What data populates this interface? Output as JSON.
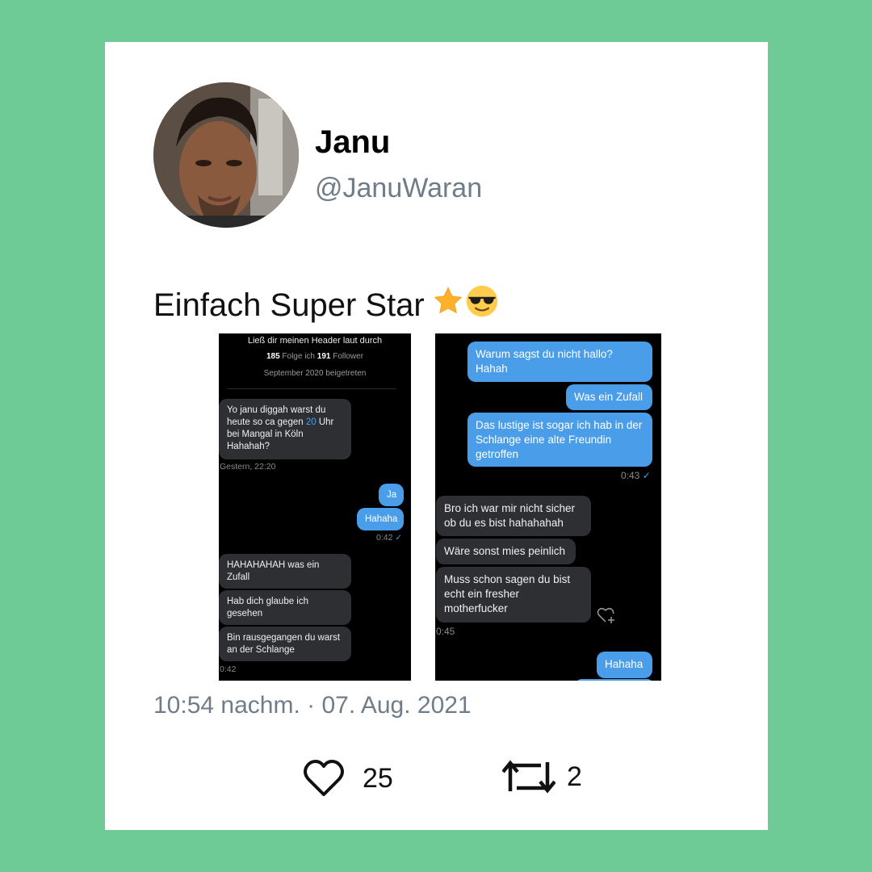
{
  "author": {
    "name": "Janu",
    "handle": "@JanuWaran"
  },
  "tweet": {
    "text": "Einfach Super Star",
    "timestamp": "10:54 nachm. · 07. Aug. 2021"
  },
  "engagement": {
    "likes": "25",
    "retweets": "2"
  },
  "screenshot_left": {
    "header_title": "Ließ dir meinen Header laut durch",
    "following_count": "185",
    "following_label": " Folge ich ",
    "followers_count": "191",
    "followers_label": " Follower",
    "joined": "September 2020 beigetreten",
    "msg1_pre": "Yo janu diggah warst du heute so ca gegen ",
    "msg1_link": "20",
    "msg1_post": " Uhr bei Mangal in Köln Hahahah?",
    "msg1_time": "Gestern, 22:20",
    "reply1": "Ja",
    "reply2": "Hahaha",
    "reply_time": "0:42",
    "msg2": "HAHAHAHAH was ein Zufall",
    "msg3": "Hab dich glaube ich gesehen",
    "msg4": "Bin rausgegangen du warst an der Schlange",
    "msg4_time": "0:42"
  },
  "screenshot_right": {
    "sent1": "Warum sagst du nicht hallo? Hahah",
    "sent2": "Was ein Zufall",
    "sent3": "Das lustige ist sogar ich hab in der Schlange eine alte Freundin getroffen",
    "sent_time": "0:43",
    "recv1": "Bro ich war mir nicht sicher ob du es bist hahahahah",
    "recv2": "Wäre sonst mies peinlich",
    "recv3": "Muss schon sagen du bist echt ein fresher motherfucker",
    "recv_time": "0:45",
    "sent4": "Hahaha"
  },
  "colors": {
    "background": "#6fcb95",
    "bubble_sent": "#4a9de8",
    "bubble_received": "#2e2f33"
  },
  "icons": {
    "like": "heart-outline-icon",
    "retweet": "retweet-icon",
    "emoji1": "star-emoji",
    "emoji2": "sunglasses-emoji",
    "heart_react": "heart-plus-icon"
  }
}
